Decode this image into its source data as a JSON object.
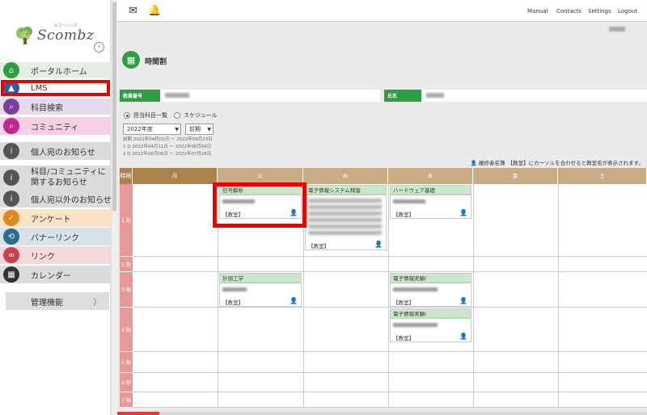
{
  "sidebar": {
    "logo_text": "Scombz",
    "logo_subtext": "スコーンバズ",
    "collapse_icon": "‹",
    "items": [
      {
        "label": "ポータルホーム",
        "icon": "home-icon",
        "icon_glyph": "⌂",
        "bg": "#e6efe6",
        "icon_color": "#2e9d44"
      },
      {
        "label": "LMS",
        "icon": "graduation-cap-icon",
        "icon_glyph": "▲",
        "bg": "#ffffff",
        "icon_color": "#2a5db0"
      },
      {
        "label": "科目検索",
        "icon": "search-icon",
        "icon_glyph": "⌕",
        "bg": "#e8d9ef",
        "icon_color": "#7b3f9e"
      },
      {
        "label": "コミュニティ",
        "icon": "search-icon",
        "icon_glyph": "⌕",
        "bg": "#f5cfe3",
        "icon_color": "#c0288a"
      },
      {
        "label": "個人宛のお知らせ",
        "icon": "info-icon",
        "icon_glyph": "i",
        "bg": "#dcdcdc",
        "icon_color": "#555555"
      },
      {
        "label": "科目/コミュニティに関するお知らせ",
        "icon": "info-icon",
        "icon_glyph": "i",
        "bg": "#dcdcdc",
        "icon_color": "#555555"
      },
      {
        "label": "個人宛以外のお知らせ",
        "icon": "info-icon",
        "icon_glyph": "i",
        "bg": "#dcdcdc",
        "icon_color": "#555555"
      },
      {
        "label": "アンケート",
        "icon": "checkbox-icon",
        "icon_glyph": "✓",
        "bg": "#fbe3c5",
        "icon_color": "#e08a1e"
      },
      {
        "label": "バナーリンク",
        "icon": "banner-icon",
        "icon_glyph": "⟲",
        "bg": "#d7e3e8",
        "icon_color": "#2a6f8a"
      },
      {
        "label": "リンク",
        "icon": "link-icon",
        "icon_glyph": "∞",
        "bg": "#f5d9dc",
        "icon_color": "#c9404f"
      },
      {
        "label": "カレンダー",
        "icon": "calendar-icon",
        "icon_glyph": "▦",
        "bg": "#dcdcdc",
        "icon_color": "#333333"
      }
    ],
    "admin_label": "管理機能",
    "admin_chevron": "〉"
  },
  "topbar": {
    "chat_icon": "✉",
    "bell_icon": "🔔",
    "links": [
      "Manual",
      "Contacts",
      "Settings",
      "Logout"
    ]
  },
  "page": {
    "title": "時間割",
    "title_icon": "▦",
    "faculty_no_label": "教員番号",
    "name_label": "氏名",
    "radio_options": [
      "担当科目一覧",
      "スケジュール"
    ],
    "year_select": "2022年度",
    "term_select": "前期",
    "periods": [
      "前期 2022年04月01日 ～ 2022年09月23日",
      "1 Q 2022年04月11日 ～ 2022年06月04日",
      "2 Q 2022年06月06日 ～ 2022年07月26日"
    ],
    "hint_icon": "👤",
    "hint_text": "履修者名簿　【教室】にカーソルを合わせると教室名が表示されます。"
  },
  "timetable": {
    "corner": "時限",
    "days": [
      "月",
      "火",
      "水",
      "木",
      "金",
      "土"
    ],
    "periods": [
      "1 限",
      "2 限",
      "3 限",
      "4 限",
      "5 限",
      "6 限",
      "7 限"
    ],
    "courses": [
      {
        "name": "信号解析",
        "room": "【教室】",
        "day": 1,
        "period": 0
      },
      {
        "name": "電子情報システム特論",
        "room": "【教室】",
        "day": 2,
        "period": 0
      },
      {
        "name": "ハードウェア基礎",
        "room": "【教室】",
        "day": 3,
        "period": 0
      },
      {
        "name": "計測工学",
        "room": "【教室】",
        "day": 1,
        "period": 2
      },
      {
        "name": "電子情報実験Ⅰ",
        "room": "【教室】",
        "day": 3,
        "period": 2
      },
      {
        "name": "電子情報実験Ⅰ",
        "room": "【教室】",
        "day": 3,
        "period": 3
      }
    ],
    "person_icon": "👤"
  },
  "colors": {
    "accent_green": "#2e9d44",
    "day_header": "#c9ac83",
    "period_header": "#e79898",
    "highlight_red": "#e00000"
  }
}
